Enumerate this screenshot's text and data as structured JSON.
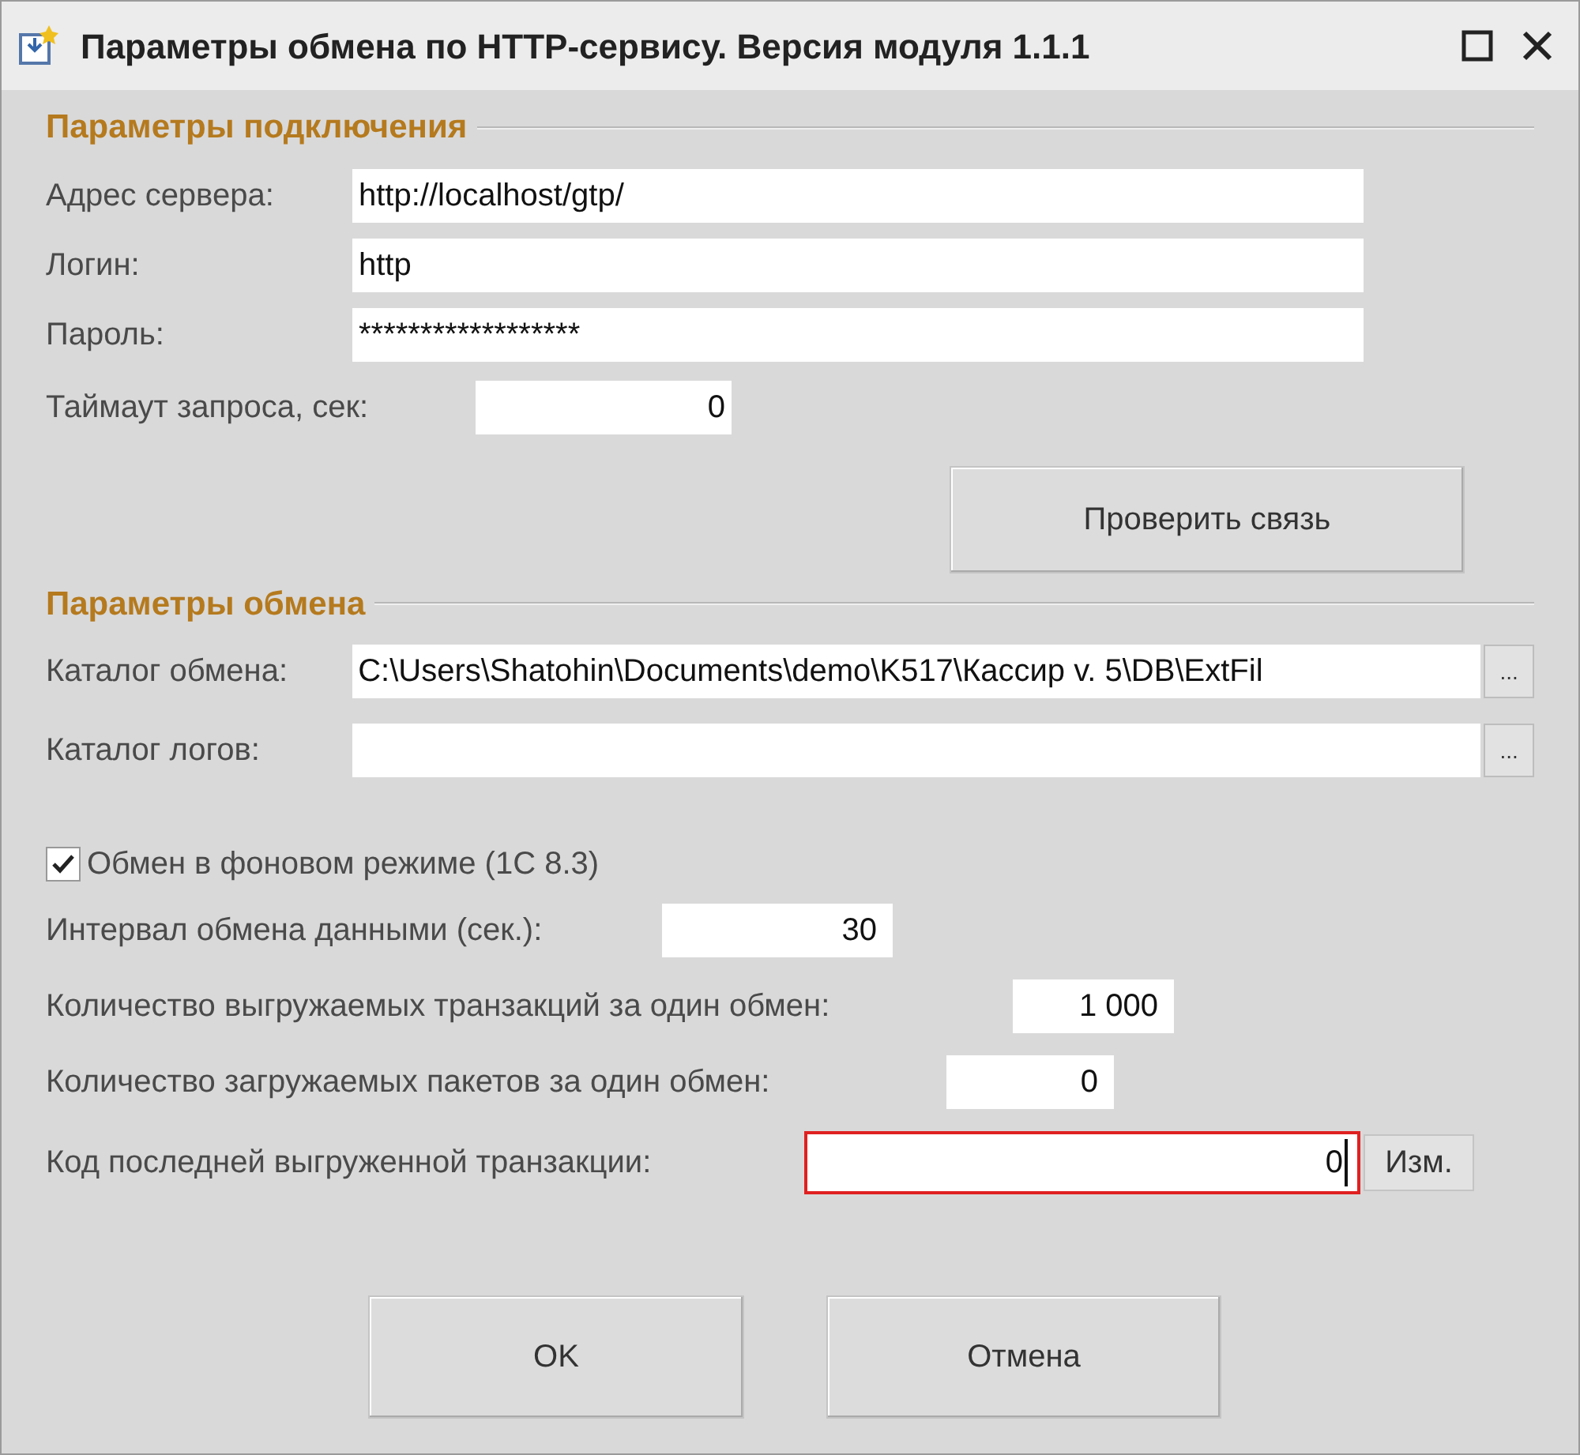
{
  "window": {
    "title": "Параметры обмена по HTTP-сервису. Версия модуля 1.1.1"
  },
  "connection": {
    "heading": "Параметры подключения",
    "fields": [
      {
        "label": "Адрес сервера:",
        "value": "http://localhost/gtp/"
      },
      {
        "label": "Логин:",
        "value": "http"
      },
      {
        "label": "Пароль:",
        "value": "******************"
      }
    ],
    "timeout": {
      "label": "Таймаут запроса, сек:",
      "value": "0"
    },
    "check_button": "Проверить связь"
  },
  "exchange": {
    "heading": "Параметры обмена",
    "folders": [
      {
        "label": "Каталог обмена:",
        "value": "C:\\Users\\Shatohin\\Documents\\demo\\K517\\Кассир v. 5\\DB\\ExtFil",
        "button": "..."
      },
      {
        "label": "Каталог логов:",
        "button": "..."
      }
    ],
    "background": {
      "label": "Обмен в фоновом режиме (1С 8.3)",
      "checked": true
    },
    "numbers": [
      {
        "label": "Интервал обмена данными (сек.):",
        "value": "30"
      },
      {
        "label": "Количество выгружаемых транзакций за один обмен:",
        "value": "1 000"
      },
      {
        "label": "Количество загружаемых пакетов за один обмен:",
        "value": "0"
      }
    ],
    "last_code": {
      "label": "Код последней выгруженной транзакции:",
      "value": "0",
      "focused": true,
      "button": "Изм."
    }
  },
  "buttons": [
    "OK",
    "Отмена"
  ]
}
